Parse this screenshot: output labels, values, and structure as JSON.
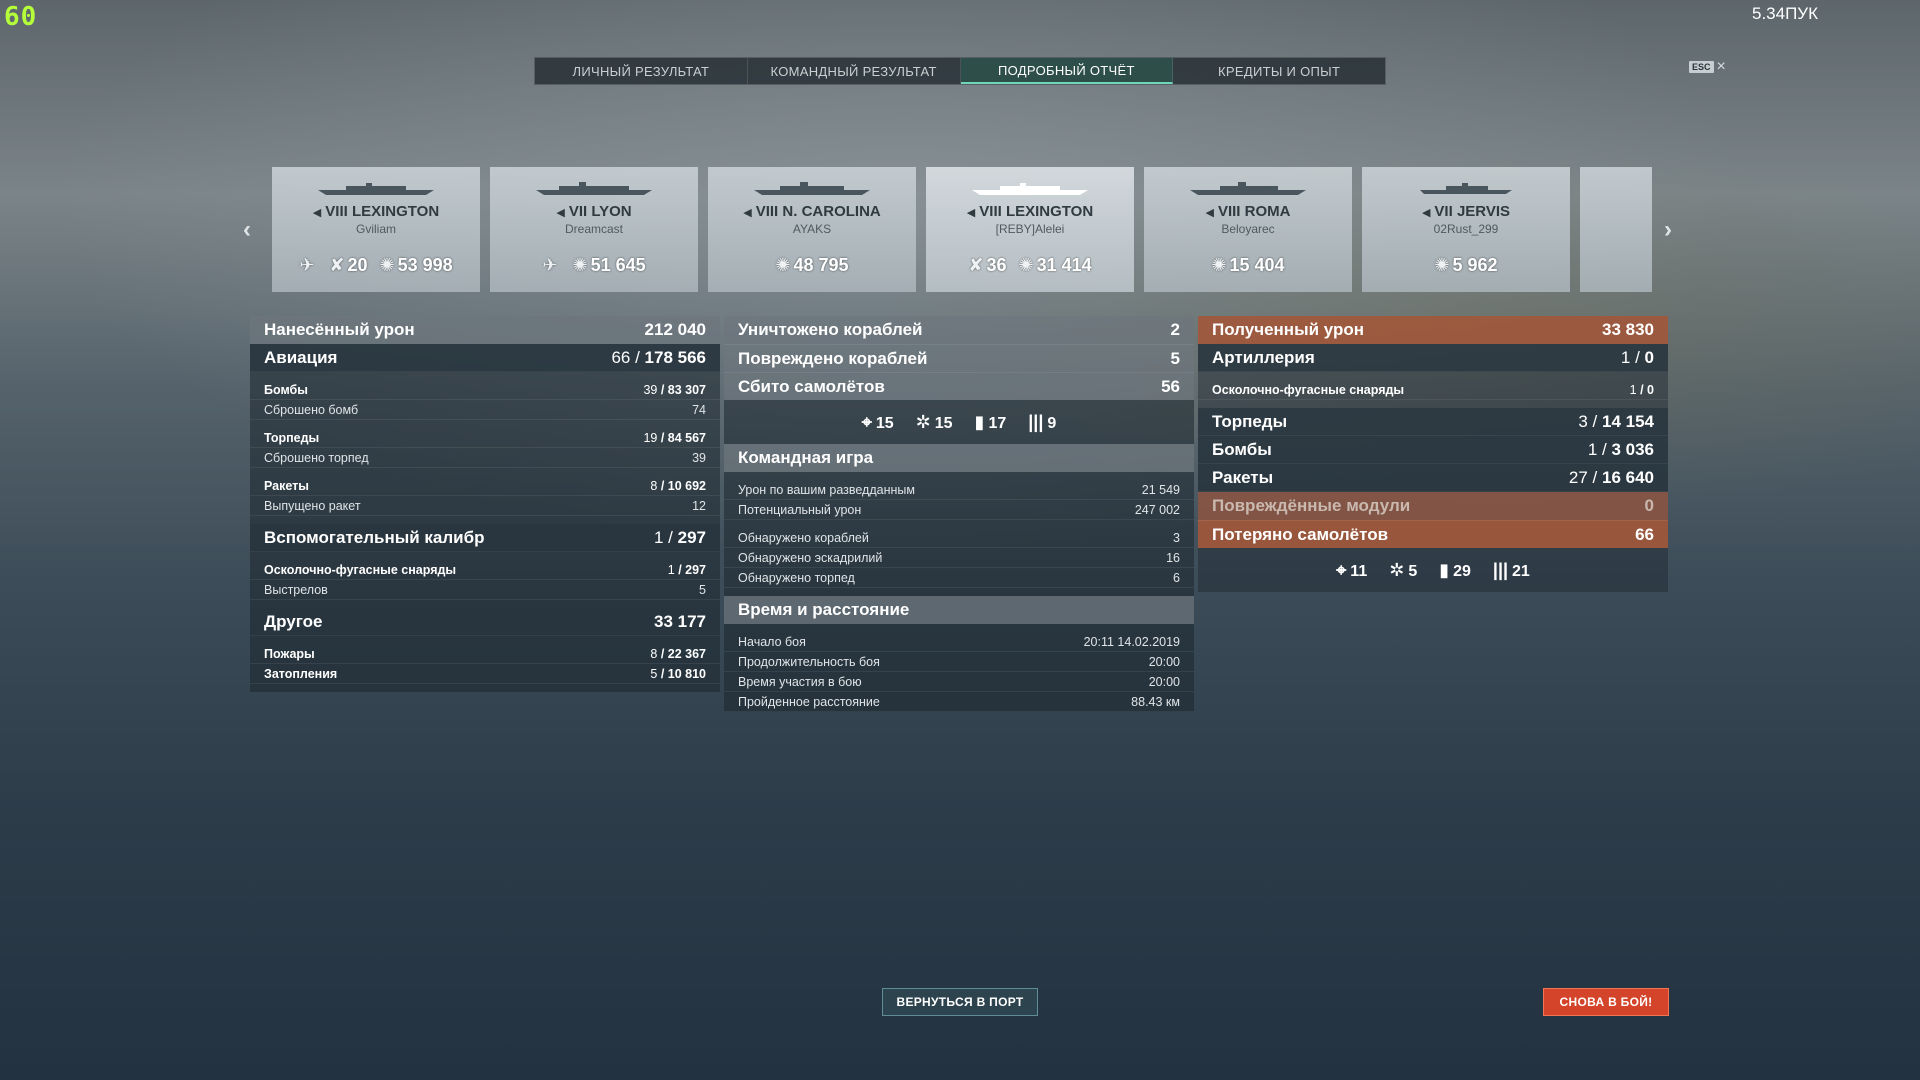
{
  "fps": "60",
  "top_right": "5.34ПУК",
  "tabs": [
    {
      "label": "Личный результат"
    },
    {
      "label": "Командный результат"
    },
    {
      "label": "Подробный отчёт"
    },
    {
      "label": "Кредиты и опыт"
    }
  ],
  "esc": {
    "key": "ESC",
    "close": "×"
  },
  "ships": [
    {
      "tier": "VIII",
      "name": "LEXINGTON",
      "player": "Gviliam",
      "stats": [
        {
          "icon": "plane-icon",
          "value": ""
        },
        {
          "icon": "crossed-planes-icon",
          "value": "20"
        },
        {
          "icon": "explosion-icon",
          "value": "53 998"
        }
      ]
    },
    {
      "tier": "VII",
      "name": "LYON",
      "player": "Dreamcast",
      "stats": [
        {
          "icon": "plane-icon",
          "value": ""
        },
        {
          "icon": "explosion-icon",
          "value": "51 645"
        }
      ]
    },
    {
      "tier": "VIII",
      "name": "N. CAROLINA",
      "player": "AYAKS",
      "stats": [
        {
          "icon": "explosion-icon",
          "value": "48 795"
        }
      ]
    },
    {
      "tier": "VIII",
      "name": "LEXINGTON",
      "player": "[REBY]Alelei",
      "stats": [
        {
          "icon": "crossed-planes-icon",
          "value": "36"
        },
        {
          "icon": "explosion-icon",
          "value": "31 414"
        }
      ]
    },
    {
      "tier": "VIII",
      "name": "ROMA",
      "player": "Beloyarec",
      "stats": [
        {
          "icon": "explosion-icon",
          "value": "15 404"
        }
      ]
    },
    {
      "tier": "VII",
      "name": "JERVIS",
      "player": "02Rust_299",
      "stats": [
        {
          "icon": "explosion-icon",
          "value": "5 962"
        }
      ]
    }
  ],
  "left": {
    "damage": {
      "label": "Нанесённый урон",
      "value": "212 040"
    },
    "aviation": {
      "label": "Авиация",
      "hits": "66",
      "value": "178 566"
    },
    "bombs": {
      "label": "Бомбы",
      "hits": "39",
      "value": "83 307"
    },
    "bombs_dropped": {
      "label": "Сброшено бомб",
      "value": "74"
    },
    "torps": {
      "label": "Торпеды",
      "hits": "19",
      "value": "84 567"
    },
    "torps_dropped": {
      "label": "Сброшено торпед",
      "value": "39"
    },
    "rockets": {
      "label": "Ракеты",
      "hits": "8",
      "value": "10 692"
    },
    "rockets_fired": {
      "label": "Выпущено ракет",
      "value": "12"
    },
    "secondary": {
      "label": "Вспомогательный калибр",
      "hits": "1",
      "value": "297"
    },
    "he": {
      "label": "Осколочно-фугасные снаряды",
      "hits": "1",
      "value": "297"
    },
    "shots": {
      "label": "Выстрелов",
      "value": "5"
    },
    "other": {
      "label": "Другое",
      "value": "33 177"
    },
    "fires": {
      "label": "Пожары",
      "hits": "8",
      "value": "22 367"
    },
    "floods": {
      "label": "Затопления",
      "hits": "5",
      "value": "10 810"
    }
  },
  "middle": {
    "destroyed": {
      "label": "Уничтожено кораблей",
      "value": "2"
    },
    "damaged": {
      "label": "Повреждено кораблей",
      "value": "5"
    },
    "planes": {
      "label": "Сбито самолётов",
      "value": "56"
    },
    "plane_icons": [
      {
        "icon": "crosshair-icon",
        "glyph": "⌖",
        "value": "15"
      },
      {
        "icon": "fighter-shot-icon",
        "glyph": "✲",
        "value": "15"
      },
      {
        "icon": "bomb-icon",
        "glyph": "▮",
        "value": "17"
      },
      {
        "icon": "rockets-icon",
        "glyph": "|||",
        "value": "9"
      }
    ],
    "team": {
      "title": "Командная игра",
      "spotting_damage": {
        "label": "Урон по вашим разведданным",
        "value": "21 549"
      },
      "potential": {
        "label": "Потенциальный урон",
        "value": "247 002"
      },
      "ships_spotted": {
        "label": "Обнаружено кораблей",
        "value": "3"
      },
      "squads_spotted": {
        "label": "Обнаружено эскадрилий",
        "value": "16"
      },
      "torps_spotted": {
        "label": "Обнаружено торпед",
        "value": "6"
      }
    },
    "time": {
      "title": "Время и расстояние",
      "start": {
        "label": "Начало боя",
        "value": "20:11  14.02.2019"
      },
      "duration": {
        "label": "Продолжительность боя",
        "value": "20:00"
      },
      "in_battle": {
        "label": "Время участия в бою",
        "value": "20:00"
      },
      "distance": {
        "label": "Пройденное расстояние",
        "value": "88.43 км"
      }
    }
  },
  "right": {
    "received": {
      "label": "Полученный урон",
      "value": "33 830"
    },
    "artillery": {
      "label": "Артиллерия",
      "hits": "1",
      "value": "0"
    },
    "he": {
      "label": "Осколочно-фугасные снаряды",
      "hits": "1",
      "value": "0"
    },
    "torps": {
      "label": "Торпеды",
      "hits": "3",
      "value": "14 154"
    },
    "bombs": {
      "label": "Бомбы",
      "hits": "1",
      "value": "3 036"
    },
    "rockets": {
      "label": "Ракеты",
      "hits": "27",
      "value": "16 640"
    },
    "modules": {
      "label": "Повреждённые модули",
      "value": "0"
    },
    "planes_lost": {
      "label": "Потеряно самолётов",
      "value": "66"
    },
    "plane_icons": [
      {
        "icon": "crosshair-icon",
        "glyph": "⌖",
        "value": "11"
      },
      {
        "icon": "fighter-shot-icon",
        "glyph": "✲",
        "value": "5"
      },
      {
        "icon": "bomb-icon",
        "glyph": "▮",
        "value": "29"
      },
      {
        "icon": "rockets-icon",
        "glyph": "|||",
        "value": "21"
      }
    ]
  },
  "buttons": {
    "port": "Вернуться в порт",
    "battle": "Снова в бой!"
  }
}
